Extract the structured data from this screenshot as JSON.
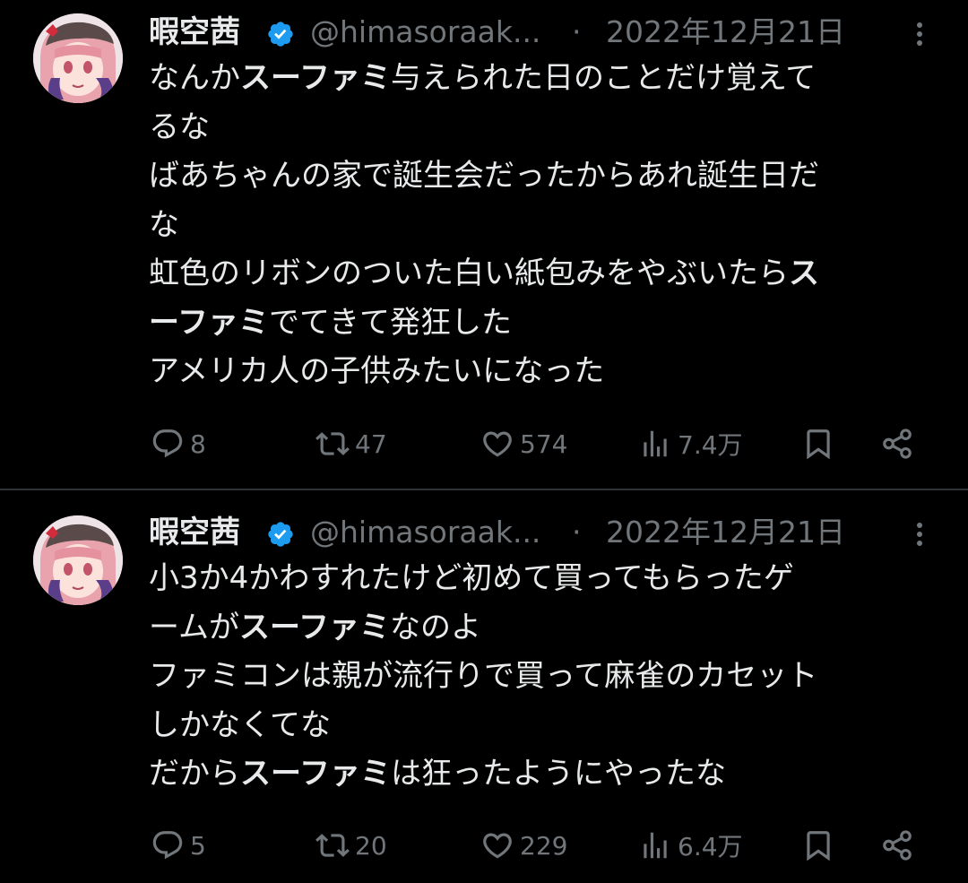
{
  "colors": {
    "background": "#000000",
    "text": "#e7e9ea",
    "muted": "#71767b",
    "verified": "#1d9bf0",
    "divider": "#2f3336"
  },
  "tweets": [
    {
      "author": {
        "name": "暇空茜",
        "handle": "@himasoraak...",
        "separator": "·",
        "date": "2022年12月21日",
        "verified_icon": "verified-badge-icon"
      },
      "lines": [
        [
          {
            "t": "なんか"
          },
          {
            "t": "スーファミ",
            "bold": true
          },
          {
            "t": "与えられた日のことだけ覚えて"
          }
        ],
        [
          {
            "t": "るな"
          }
        ],
        [
          {
            "t": "ばあちゃんの家で誕生会だったからあれ誕生日だ"
          }
        ],
        [
          {
            "t": "な"
          }
        ],
        [
          {
            "t": "虹色のリボンのついた白い紙包みをやぶいたら"
          },
          {
            "t": "ス",
            "bold": true
          }
        ],
        [
          {
            "t": "ーファミ",
            "bold": true
          },
          {
            "t": "でてきて発狂した"
          }
        ],
        [
          {
            "t": "アメリカ人の子供みたいになった"
          }
        ]
      ],
      "stats": {
        "replies": "8",
        "retweets": "47",
        "likes": "574",
        "views": "7.4万"
      }
    },
    {
      "author": {
        "name": "暇空茜",
        "handle": "@himasoraak...",
        "separator": "·",
        "date": "2022年12月21日",
        "verified_icon": "verified-badge-icon"
      },
      "lines": [
        [
          {
            "t": "小3か4かわすれたけど初めて買ってもらったゲ"
          }
        ],
        [
          {
            "t": "ームが"
          },
          {
            "t": "スーファミ",
            "bold": true
          },
          {
            "t": "なのよ"
          }
        ],
        [
          {
            "t": "ファミコンは親が流行りで買って麻雀のカセット"
          }
        ],
        [
          {
            "t": "しかなくてな"
          }
        ],
        [
          {
            "t": "だから"
          },
          {
            "t": "スーファミ",
            "bold": true
          },
          {
            "t": "は狂ったようにやったな"
          }
        ]
      ],
      "stats": {
        "replies": "5",
        "retweets": "20",
        "likes": "229",
        "views": "6.4万"
      }
    }
  ]
}
